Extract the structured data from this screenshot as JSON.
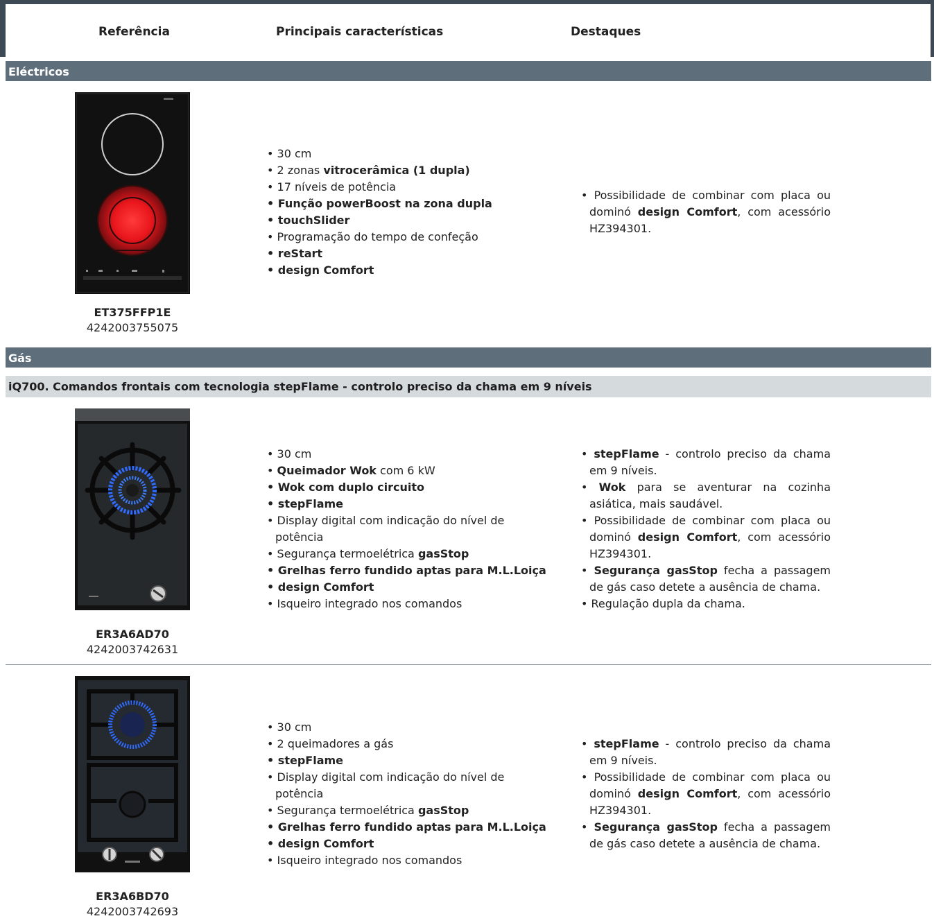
{
  "header": {
    "col_reference": "Referência",
    "col_features": "Principais características",
    "col_highlights": "Destaques"
  },
  "sections": {
    "electric": "Eléctricos",
    "gas": "Gás",
    "gas_subtitle": "iQ700. Comandos frontais com tecnologia stepFlame - controlo preciso da chama em 9 níveis"
  },
  "products": [
    {
      "model": "ET375FFP1E",
      "ean": "4242003755075",
      "features": {
        "f1": "30 cm",
        "f2a": "2 zonas ",
        "f2b": "vitrocerâmica (1 dupla)",
        "f3": "17 níveis de potência",
        "f4": "Função powerBoost na zona dupla",
        "f5": "touchSlider",
        "f6": "Programação do tempo de confeção",
        "f7": "reStart",
        "f8": "design Comfort"
      },
      "highlights": {
        "h1a": "Possibilidade de combinar com placa ou dominó ",
        "h1b": "design Comfort",
        "h1c": ", com acessório HZ394301."
      }
    },
    {
      "model": "ER3A6AD70",
      "ean": "4242003742631",
      "features": {
        "f1": "30 cm",
        "f2a": "Queimador Wok",
        "f2b": " com 6 kW",
        "f3": "Wok com duplo circuito",
        "f4": "stepFlame",
        "f5": "Display digital com indicação do nível de potência",
        "f6a": "Segurança termoelétrica ",
        "f6b": "gasStop",
        "f7": "Grelhas ferro fundido aptas para M.L.Loiça",
        "f8": "design Comfort",
        "f9": "Isqueiro integrado nos comandos"
      },
      "highlights": {
        "h1a": "stepFlame",
        "h1b": " - controlo preciso da chama em 9 níveis.",
        "h2a": "Wok",
        "h2b": " para se aventurar na cozinha asiática, mais saudável.",
        "h3a": "Possibilidade de combinar com placa ou dominó ",
        "h3b": "design Comfort",
        "h3c": ", com acessório HZ394301.",
        "h4a": "Segurança gasStop",
        "h4b": " fecha a passagem de gás caso detete a ausência de chama.",
        "h5": "Regulação dupla da chama."
      }
    },
    {
      "model": "ER3A6BD70",
      "ean": "4242003742693",
      "features": {
        "f1": "30 cm",
        "f2": "2 queimadores a gás",
        "f3": "stepFlame",
        "f4": "Display digital com indicação do nível de potência",
        "f5a": "Segurança termoelétrica ",
        "f5b": "gasStop",
        "f6": "Grelhas ferro fundido aptas para M.L.Loiça",
        "f7": "design Comfort",
        "f8": "Isqueiro integrado nos comandos"
      },
      "highlights": {
        "h1a": "stepFlame",
        "h1b": " - controlo preciso da chama em 9 níveis.",
        "h2a": "Possibilidade de combinar com placa ou dominó ",
        "h2b": "design Comfort",
        "h2c": ", com acessório HZ394301.",
        "h3a": "Segurança gasStop",
        "h3b": " fecha a passagem de gás caso detete a ausência de chama."
      }
    }
  ]
}
